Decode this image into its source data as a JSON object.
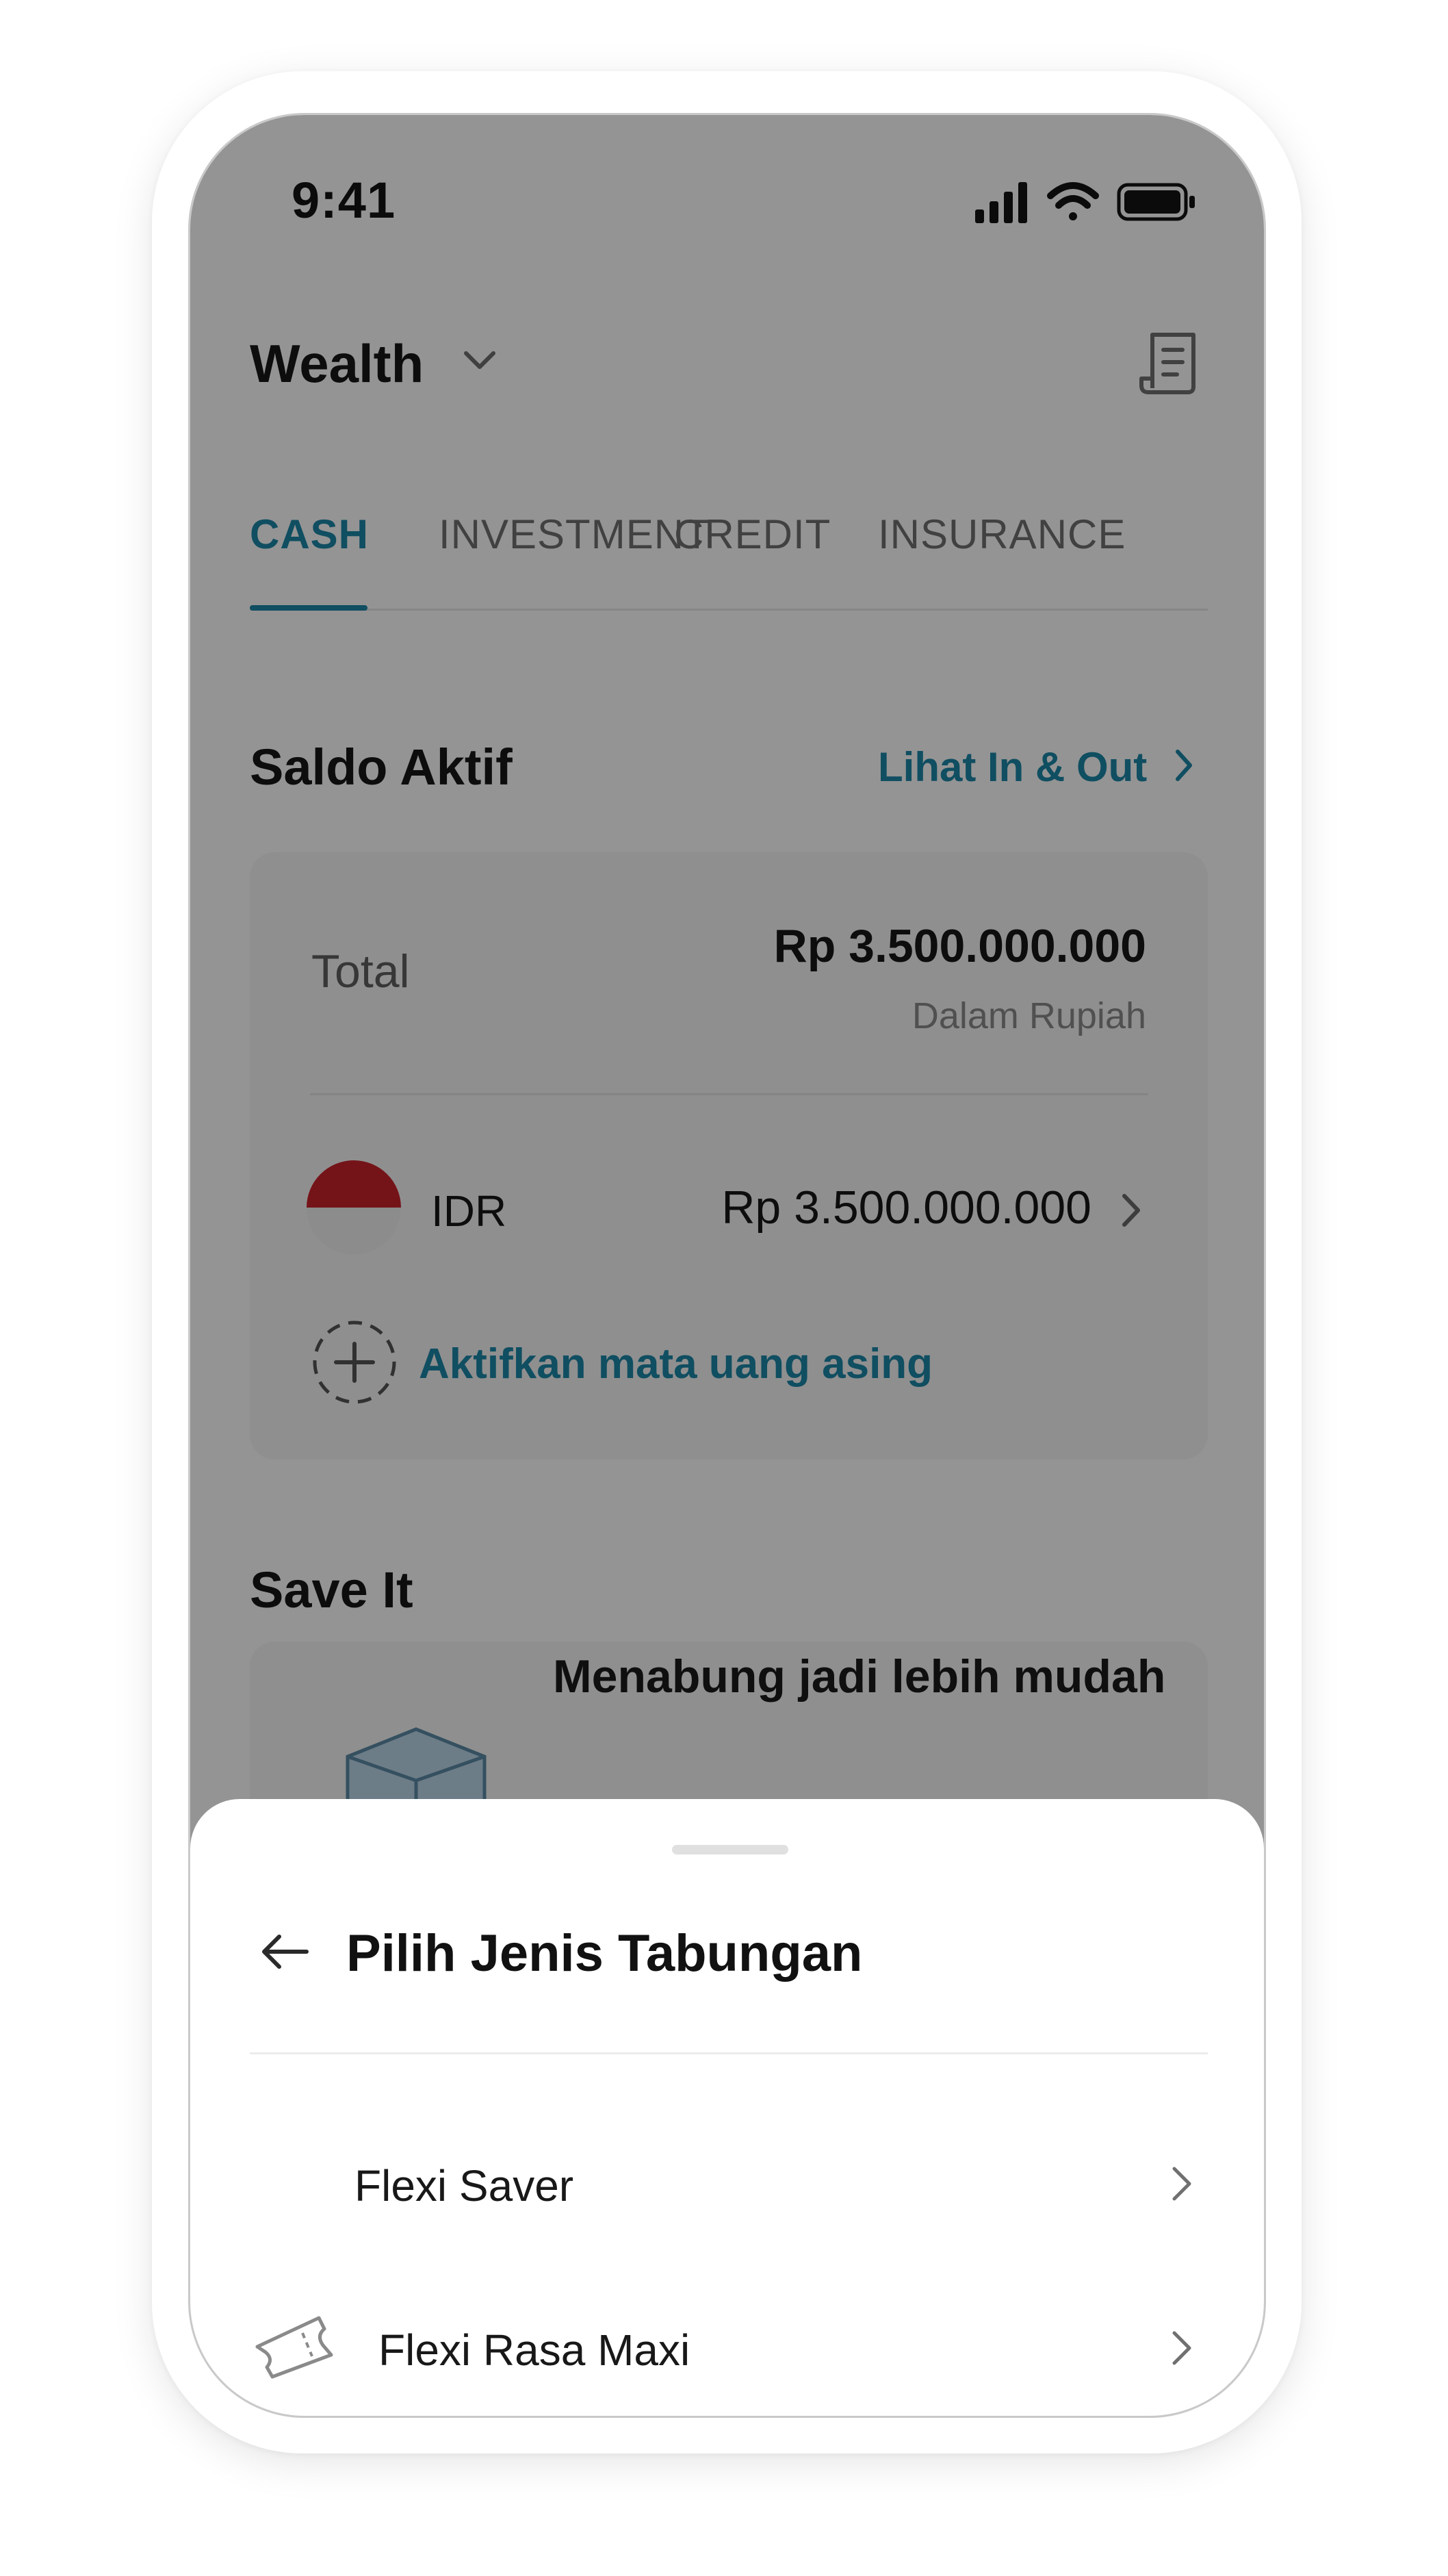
{
  "status_bar": {
    "time": "9:41"
  },
  "header": {
    "title": "Wealth"
  },
  "tabs": [
    {
      "label": "CASH",
      "active": true
    },
    {
      "label": "INVESTMENT",
      "active": false
    },
    {
      "label": "CREDIT",
      "active": false
    },
    {
      "label": "INSURANCE",
      "active": false
    }
  ],
  "saldo_aktif": {
    "title": "Saldo Aktif",
    "link_label": "Lihat In & Out",
    "total_label": "Total",
    "total_amount": "Rp 3.500.000.000",
    "total_sub": "Dalam Rupiah",
    "currency": {
      "code": "IDR",
      "amount": "Rp 3.500.000.000"
    },
    "add_currency_label": "Aktifkan mata uang asing"
  },
  "save_it": {
    "title": "Save It",
    "promo_text": "Menabung jadi lebih mudah"
  },
  "bottom_sheet": {
    "title": "Pilih Jenis Tabungan",
    "items": [
      {
        "label": "Flexi Saver",
        "icon": "safe-icon"
      },
      {
        "label": "Flexi Rasa Maxi",
        "icon": "ticket-icon"
      }
    ]
  },
  "colors": {
    "accent": "#1d87a7",
    "overlay": "rgba(0,0,0,0.42)",
    "flag_red": "#c8232c"
  }
}
